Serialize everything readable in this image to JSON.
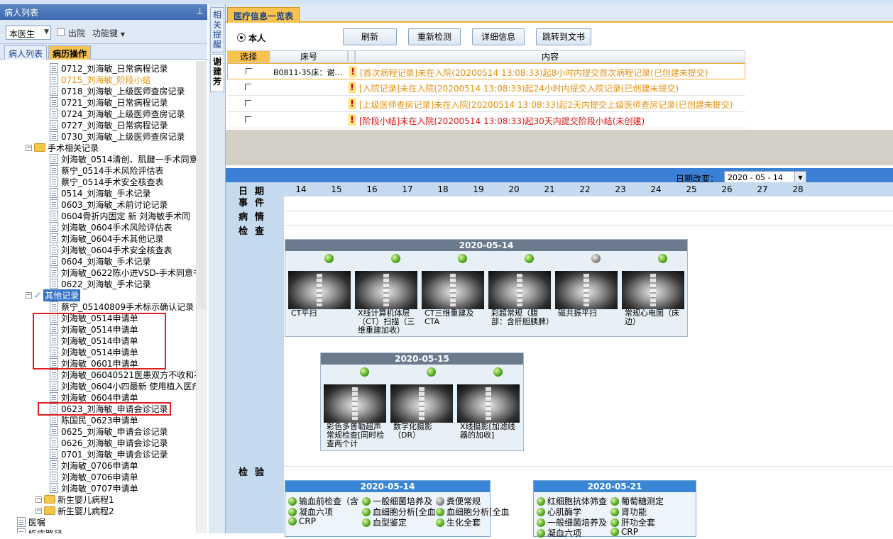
{
  "left_panel": {
    "title": "病人列表",
    "doctor_select": "本医生",
    "discharge_label": "出院",
    "function_key": "功能键",
    "tabs": [
      "病人列表",
      "病历操作"
    ],
    "tree": {
      "items_top": [
        {
          "label": "0712_刘海敏_日常病程记录",
          "orange": false
        },
        {
          "label": "0715_刘海敏_阶段小结",
          "orange": true
        },
        {
          "label": "0718_刘海敏_上级医师查房记录",
          "orange": false
        },
        {
          "label": "0721_刘海敏_日常病程记录",
          "orange": false
        },
        {
          "label": "0724_刘海敏_上级医师查房记录",
          "orange": false
        },
        {
          "label": "0727_刘海敏_日常病程记录",
          "orange": false
        },
        {
          "label": "0730_刘海敏_上级医师查房记录",
          "orange": false
        }
      ],
      "folder_surgery": "手术相关记录",
      "surgery_items": [
        "刘海敏_0514清创、肌腱一手术同意",
        "蔡宁_0514手术风险评估表",
        "蔡宁_0514手术安全核查表",
        "0514_刘海敏_手术记录",
        "0603_刘海敏_术前讨论记录",
        "0604骨折内固定 新  刘海敏手术同",
        "刘海敏_0604手术风险评估表",
        "刘海敏_0604手术其他记录",
        "刘海敏_0604手术安全核查表",
        "0604_刘海敏_手术记录",
        "刘海敏_0622陈小进VSD-手术同意书",
        "0622_刘海敏_手术记录"
      ],
      "folder_other": "其他记录",
      "other_items": [
        "蔡宁_05140809手术标示确认记录",
        "刘海敏_0514申请单",
        "刘海敏_0514申请单",
        "刘海敏_0514申请单",
        "刘海敏_0514申请单",
        "刘海敏_0601申请单",
        "刘海敏_06040521医患双方不收和不",
        "刘海敏_0604小四最新 使用植入医疗",
        "刘海敏_0604申请单",
        "0623_刘海敏_申请会诊记录",
        "陈国民_0623申请单",
        "0625_刘海敏_申请会诊记录",
        "0626_刘海敏_申请会诊记录",
        "0701_刘海敏_申请会诊记录",
        "刘海敏_0706申请单",
        "刘海敏_0706申请单",
        "刘海敏_0707申请单"
      ],
      "folder_newborn1": "新生婴儿病程1",
      "folder_newborn2": "新生婴儿病程2",
      "orders": "医嘱",
      "pathway": "临床路径"
    }
  },
  "vertical_tabs": [
    "相关提醒",
    "谢建芳"
  ],
  "main": {
    "tab_title": "医疗信息一览表",
    "radio_label": "本人",
    "buttons": [
      "刷新",
      "重新检测",
      "详细信息",
      "跳转到文书"
    ],
    "table_headers": [
      "选择",
      "床号",
      "内容"
    ],
    "rows": [
      {
        "bed": "B0811-35床：谢…",
        "content": "[首次病程记录]未在入院(20200514  13:08:33)起8小时内提交首次病程记录(已创建未提交)",
        "color": "#e5900f"
      },
      {
        "bed": "",
        "content": "[入院记录]未在入院(20200514  13:08:33)起24小时内提交入院记录(已创建未提交)",
        "color": "#e5900f"
      },
      {
        "bed": "",
        "content": "[上级医师查房记录]未在入院(20200514  13:08:33)起2天内提交上级医师查房记录(已创建未提交)",
        "color": "#e5900f"
      },
      {
        "bed": "",
        "content": "[阶段小结]未在入院(20200514  13:08:33)起30天内提交阶段小结(未创建)",
        "color": "#dd1010"
      }
    ]
  },
  "timeline": {
    "date_change_label": "日期改变：",
    "date_value": "2020 - 05 - 14",
    "row_labels": {
      "date": "日期",
      "event": "事件",
      "condition": "病情",
      "exam": "检查",
      "lab": "检验"
    },
    "days": [
      "14",
      "15",
      "16",
      "17",
      "18",
      "19",
      "20",
      "21",
      "22",
      "23",
      "24",
      "25",
      "26",
      "27",
      "28"
    ],
    "exam_cards": [
      {
        "date": "2020-05-14",
        "items": [
          {
            "label": "CT平扫",
            "status": "green"
          },
          {
            "label": "X线计算机体层（CT）扫描（三维重建加收）",
            "status": "green"
          },
          {
            "label": "CT三维重建及CTA",
            "status": "green"
          },
          {
            "label": "彩超常规（腹部：含肝胆胰脾）",
            "status": "green"
          },
          {
            "label": "磁共振平扫",
            "status": "gray"
          },
          {
            "label": "常规心电图（床边）",
            "status": "green"
          }
        ]
      },
      {
        "date": "2020-05-15",
        "items": [
          {
            "label": "彩色多普勒超声常规检查[同时检查两个计",
            "status": "green"
          },
          {
            "label": "数字化摄影（DR）",
            "status": "green"
          },
          {
            "label": "X线摄影[加滤线器的加收]",
            "status": "green"
          }
        ]
      }
    ],
    "lab_cards": [
      {
        "date": "2020-05-14",
        "items": [
          {
            "label": "输血前检查（含",
            "status": "green"
          },
          {
            "label": "一般细菌培养及",
            "status": "green"
          },
          {
            "label": "粪便常规",
            "status": "gray"
          },
          {
            "label": "凝血六项",
            "status": "green"
          },
          {
            "label": "血细胞分析[全血",
            "status": "green"
          },
          {
            "label": "血细胞分析[全血",
            "status": "green"
          },
          {
            "label": "CRP",
            "status": "green"
          },
          {
            "label": "血型鉴定",
            "status": "green"
          },
          {
            "label": "生化全套",
            "status": "green"
          }
        ]
      },
      {
        "date": "2020-05-21",
        "items": [
          {
            "label": "红细胞抗体筛查",
            "status": "green"
          },
          {
            "label": "葡萄糖测定",
            "status": "green"
          },
          {
            "label": "心肌酶学",
            "status": "green"
          },
          {
            "label": "肾功能",
            "status": "green"
          },
          {
            "label": "一般细菌培养及",
            "status": "green"
          },
          {
            "label": "肝功全套",
            "status": "green"
          },
          {
            "label": "凝血六项",
            "status": "green"
          },
          {
            "label": "CRP",
            "status": "green"
          }
        ]
      }
    ]
  }
}
